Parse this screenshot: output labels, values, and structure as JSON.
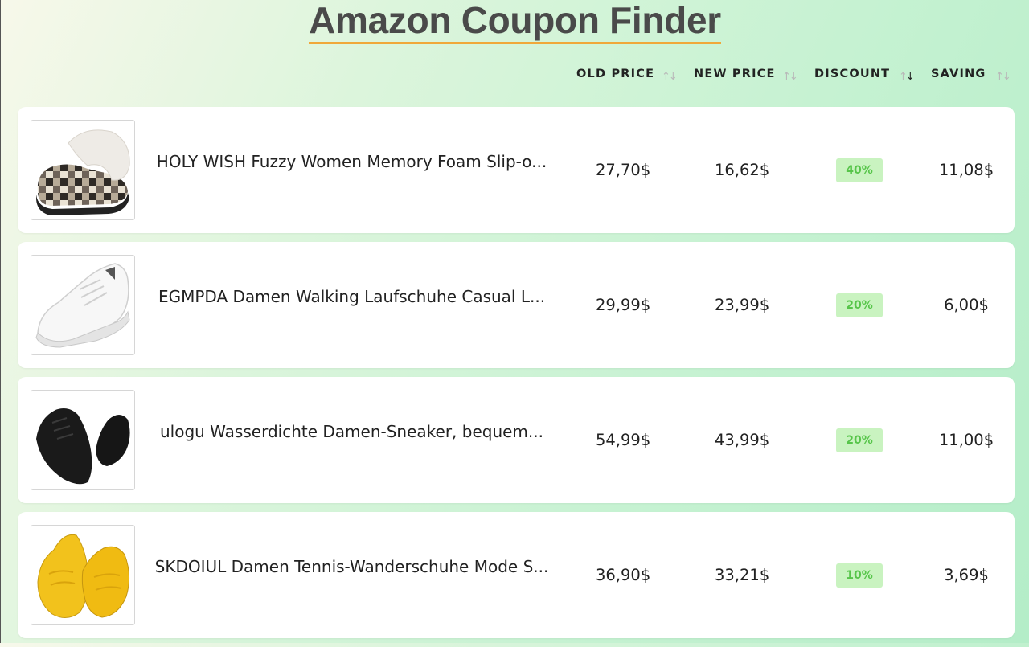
{
  "app": {
    "title": "Amazon Coupon Finder"
  },
  "columns": [
    {
      "label": "OLD PRICE",
      "sort_icon": "sort-arrows-icon"
    },
    {
      "label": "NEW PRICE",
      "sort_icon": "sort-arrows-icon"
    },
    {
      "label": "DISCOUNT",
      "sort_icon": "sort-down-active-icon"
    },
    {
      "label": "SAVING",
      "sort_icon": "sort-arrows-icon"
    }
  ],
  "products": [
    {
      "name": "HOLY WISH Fuzzy Women Memory Foam Slip-o...",
      "old_price": "27,70$",
      "new_price": "16,62$",
      "discount": "40%",
      "saving": "11,08$",
      "image": "plaid-slipper"
    },
    {
      "name": "EGMPDA Damen Walking Laufschuhe Casual L...",
      "old_price": "29,99$",
      "new_price": "23,99$",
      "discount": "20%",
      "saving": "6,00$",
      "image": "white-sneaker"
    },
    {
      "name": "ulogu Wasserdichte Damen-Sneaker, bequem...",
      "old_price": "54,99$",
      "new_price": "43,99$",
      "discount": "20%",
      "saving": "11,00$",
      "image": "black-sneakers"
    },
    {
      "name": "SKDOIUL Damen Tennis-Wanderschuhe Mode S...",
      "old_price": "36,90$",
      "new_price": "33,21$",
      "discount": "10%",
      "saving": "3,69$",
      "image": "yellow-sneakers"
    }
  ],
  "colors": {
    "accent_underline": "#f0a83a",
    "badge_bg": "#c9f3c0",
    "badge_text": "#57c54a"
  }
}
